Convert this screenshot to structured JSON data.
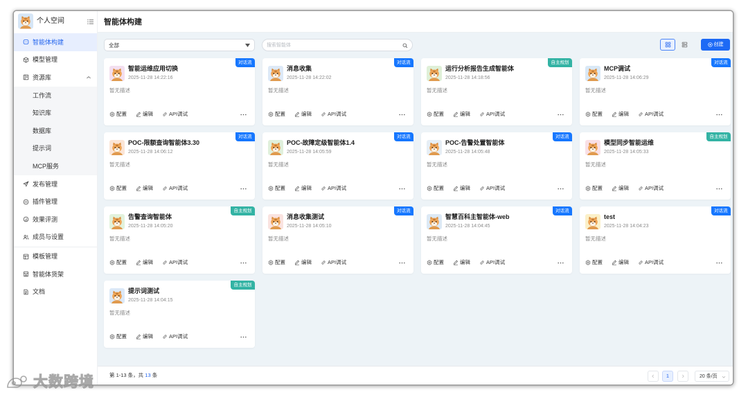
{
  "sidebar": {
    "workspace": {
      "name": "个人空间",
      "avatar_icon": "tiger-avatar-icon",
      "avatar_bg": "#d6e6f6",
      "menu_icon": "menu-icon"
    },
    "items": [
      {
        "label": "智能体构建",
        "icon": "agent-icon",
        "selected": true
      },
      {
        "label": "模型管理",
        "icon": "cube-icon"
      },
      {
        "label": "资源库",
        "icon": "library-icon",
        "expanded": true,
        "expand_icon": "chevron-up-icon",
        "children": [
          {
            "label": "工作流"
          },
          {
            "label": "知识库"
          },
          {
            "label": "数据库"
          },
          {
            "label": "提示词"
          },
          {
            "label": "MCP服务"
          }
        ]
      },
      {
        "label": "发布管理",
        "icon": "rocket-icon"
      },
      {
        "label": "插件管理",
        "icon": "plugin-icon"
      },
      {
        "label": "效果评测",
        "icon": "gauge-icon"
      },
      {
        "label": "成员与设置",
        "icon": "users-icon"
      },
      {
        "label": "模板管理",
        "icon": "template-icon"
      },
      {
        "label": "智能体货架",
        "icon": "shop-icon"
      },
      {
        "label": "文档",
        "icon": "document-icon"
      }
    ]
  },
  "header": {
    "title": "智能体构建"
  },
  "toolbar": {
    "filter": {
      "value": "全部",
      "icon": "caret-down-icon"
    },
    "search": {
      "placeholder": "搜索智能体",
      "icon": "search-icon"
    },
    "view_modes": [
      {
        "icon": "grid-view-icon",
        "selected": true
      },
      {
        "icon": "list-view-icon",
        "selected": false
      }
    ],
    "create": {
      "label": "创建",
      "icon": "plus-circle-icon"
    }
  },
  "card_actions": {
    "config": "配置",
    "edit": "编辑",
    "api": "API调试",
    "more_icon": "more-icon"
  },
  "cards": [
    {
      "title": "智能运维应用切换",
      "created": "2025-11-28 14:22:16",
      "description": "暂无描述",
      "tag": "对话流",
      "tag_color": "#1677ff",
      "avatar_bg": "#f3dff0"
    },
    {
      "title": "消息收集",
      "created": "2025-11-28 14:22:02",
      "description": "暂无描述",
      "tag": "对话流",
      "tag_color": "#1677ff",
      "avatar_bg": "#dde9f7"
    },
    {
      "title": "运行分析报告生成智能体",
      "created": "2025-11-28 14:18:56",
      "description": "暂无描述",
      "tag": "自主规划",
      "tag_color": "#33b3a4",
      "avatar_bg": "#dff0d8"
    },
    {
      "title": "MCP调试",
      "created": "2025-11-28 14:06:29",
      "description": "暂无描述",
      "tag": "对话流",
      "tag_color": "#1677ff",
      "avatar_bg": "#d9e8f6"
    },
    {
      "title": "POC-限额查询智能体3.30",
      "created": "2025-11-28 14:06:12",
      "description": "暂无描述",
      "tag": "对话流",
      "tag_color": "#1677ff",
      "avatar_bg": "#fbe5d6"
    },
    {
      "title": "POC-故障定级智能体1.4",
      "created": "2025-11-28 14:05:59",
      "description": "暂无描述",
      "tag": "对话流",
      "tag_color": "#1677ff",
      "avatar_bg": "#e0f0dc"
    },
    {
      "title": "POC-告警处置智能体",
      "created": "2025-11-28 14:05:48",
      "description": "暂无描述",
      "tag": "对话流",
      "tag_color": "#1677ff",
      "avatar_bg": "#e6eef5"
    },
    {
      "title": "模型同步智能运维",
      "created": "2025-11-28 14:05:33",
      "description": "暂无描述",
      "tag": "自主规划",
      "tag_color": "#33b3a4",
      "avatar_bg": "#f9e0e6"
    },
    {
      "title": "告警查询智能体",
      "created": "2025-11-28 14:05:20",
      "description": "暂无描述",
      "tag": "自主规划",
      "tag_color": "#33b3a4",
      "avatar_bg": "#e2f2dc"
    },
    {
      "title": "消息收集测试",
      "created": "2025-11-28 14:05:10",
      "description": "暂无描述",
      "tag": "对话流",
      "tag_color": "#1677ff",
      "avatar_bg": "#fae3e0"
    },
    {
      "title": "智慧百科主智能体-web",
      "created": "2025-11-28 14:04:45",
      "description": "暂无描述",
      "tag": "对话流",
      "tag_color": "#1677ff",
      "avatar_bg": "#dce9f5"
    },
    {
      "title": "test",
      "created": "2025-11-28 14:04:23",
      "description": "暂无描述",
      "tag": "对话流",
      "tag_color": "#1677ff",
      "avatar_bg": "#fbf0c8"
    },
    {
      "title": "提示词测试",
      "created": "2025-11-28 14:04:15",
      "description": "暂无描述",
      "tag": "自主规划",
      "tag_color": "#33b3a4",
      "avatar_bg": "#dbe8f7"
    }
  ],
  "footer": {
    "range_text": "第 1-13 条，共",
    "total": "13",
    "total_suffix": "条"
  },
  "pagination": {
    "current_page": "1",
    "page_size": "20 条/页",
    "prev_icon": "chevron-left-icon",
    "next_icon": "chevron-right-icon",
    "prev_disabled": true,
    "next_disabled": true
  },
  "theme": {
    "primary": "#1d6af5",
    "content_bg": "#edf3f7"
  },
  "watermark": {
    "text": "大数跨境"
  }
}
